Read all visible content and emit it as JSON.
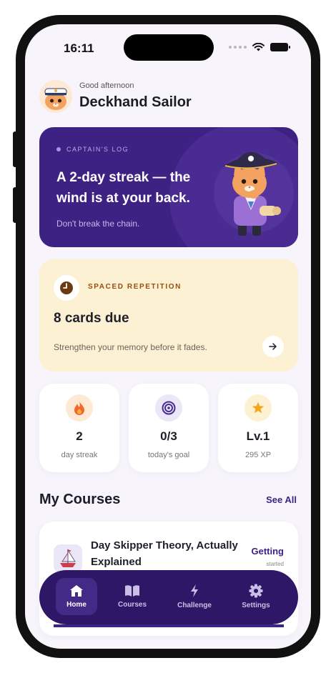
{
  "status_bar": {
    "time": "16:11"
  },
  "header": {
    "greeting": "Good afternoon",
    "username": "Deckhand Sailor"
  },
  "captain_card": {
    "tag": "CAPTAIN'S LOG",
    "title": "A 2-day streak — the wind is at your back.",
    "subtitle": "Don't break the chain.",
    "bg_color": "#3e2283"
  },
  "spaced_repetition": {
    "tag": "SPACED REPETITION",
    "title": "8 cards due",
    "subtitle": "Strengthen your memory before it fades.",
    "icon": "clock-icon",
    "arrow_icon": "arrow-right-icon"
  },
  "stats": [
    {
      "icon": "flame-icon",
      "value": "2",
      "label": "day streak"
    },
    {
      "icon": "target-icon",
      "value": "0/3",
      "label": "today's goal"
    },
    {
      "icon": "star-icon",
      "value": "Lv.1",
      "label": "295 XP"
    }
  ],
  "courses": {
    "title": "My Courses",
    "see_all": "See All",
    "items": [
      {
        "name": "Day Skipper Theory, Actually Explained",
        "status": "Getting",
        "status_sub": "started",
        "icon": "sailboat-icon"
      }
    ]
  },
  "nav": {
    "items": [
      {
        "label": "Home",
        "icon": "home-icon",
        "active": true
      },
      {
        "label": "Courses",
        "icon": "book-icon",
        "active": false
      },
      {
        "label": "Challenge",
        "icon": "lightning-icon",
        "active": false
      },
      {
        "label": "Settings",
        "icon": "gear-icon",
        "active": false
      }
    ]
  },
  "colors": {
    "accent": "#3c2384",
    "nav_bg": "#2e1766",
    "sr_bg": "#fdf1d3",
    "page_bg": "#f7f5fb"
  }
}
